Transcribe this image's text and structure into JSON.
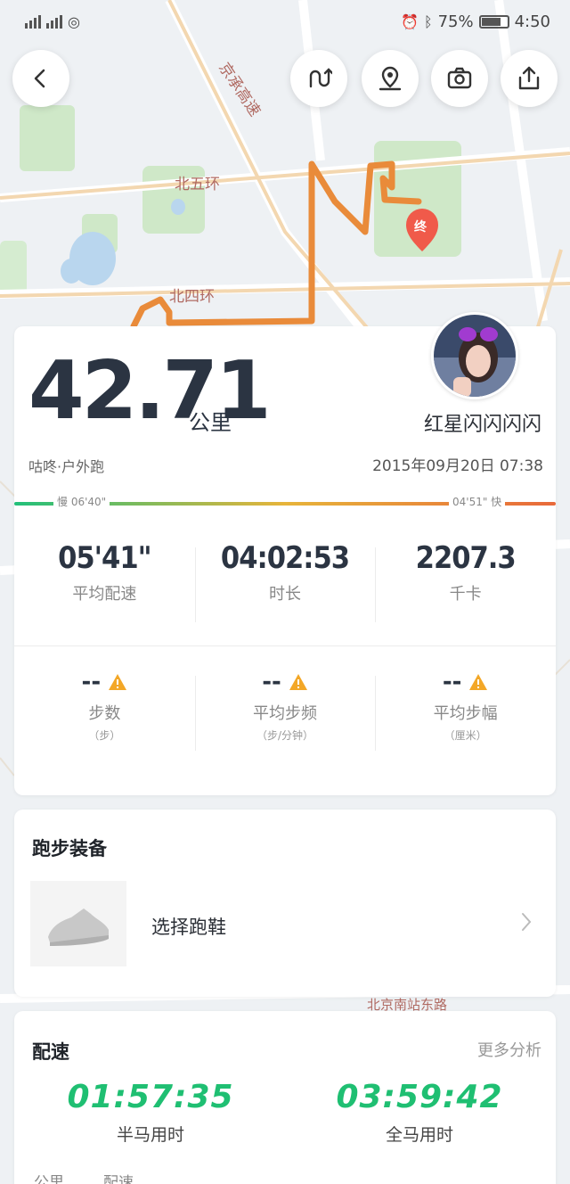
{
  "status_bar": {
    "battery": "75%",
    "time": "4:50"
  },
  "top_buttons": [
    "back",
    "route",
    "map-pin",
    "camera",
    "share"
  ],
  "map": {
    "labels": [
      "北五环",
      "北四环",
      "京承高速",
      "北京南站东路"
    ],
    "end_marker": "终",
    "route_colors": [
      "#e7a53c",
      "#e98b3a",
      "#e06a3a"
    ]
  },
  "summary": {
    "distance": "42.71",
    "distance_unit": "公里",
    "username": "红星闪闪闪闪",
    "run_type": "咕咚·户外跑",
    "date": "2015年09月20日 07:38",
    "pace_bar": {
      "slow_label": "慢 06'40\"",
      "fast_label": "04'51\" 快",
      "colors": [
        "#22c07a",
        "#e7b43a",
        "#e8693a"
      ]
    },
    "stats_primary": [
      {
        "value": "05'41\"",
        "label": "平均配速"
      },
      {
        "value": "04:02:53",
        "label": "时长"
      },
      {
        "value": "2207.3",
        "label": "千卡"
      }
    ],
    "stats_secondary": [
      {
        "value": "--",
        "label": "步数",
        "unit": "（步）"
      },
      {
        "value": "--",
        "label": "平均步频",
        "unit": "（步/分钟）"
      },
      {
        "value": "--",
        "label": "平均步幅",
        "unit": "（厘米）"
      }
    ]
  },
  "gear": {
    "title": "跑步装备",
    "shoe_prompt": "选择跑鞋"
  },
  "pace_section": {
    "title": "配速",
    "more": "更多分析",
    "half_marathon_time": "01:57:35",
    "half_marathon_label": "半马用时",
    "full_marathon_time": "03:59:42",
    "full_marathon_label": "全马用时",
    "col_km": "公里",
    "col_pace": "配速"
  }
}
